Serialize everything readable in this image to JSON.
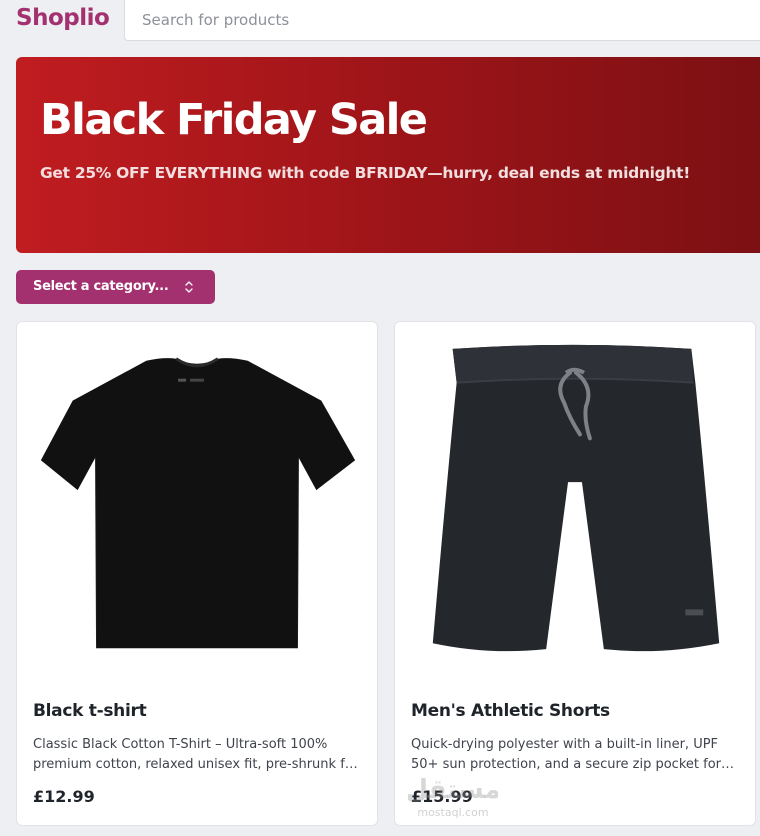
{
  "header": {
    "logo": "Shoplio",
    "search": {
      "placeholder": "Search for products",
      "value": ""
    }
  },
  "banner": {
    "title": "Black Friday Sale",
    "subtitle": "Get 25% OFF EVERYTHING with code BFRIDAY—hurry, deal ends at midnight!",
    "gradient_start": "#c01d20",
    "gradient_end": "#7b1013"
  },
  "category_select": {
    "label": "Select a category...",
    "icon": "chevron-updown-icon",
    "color": "#a3306f"
  },
  "products": [
    {
      "image": "black-tshirt-image",
      "name": "Black t-shirt",
      "description": "Classic Black Cotton T-Shirt – Ultra-soft 100% premium cotton, relaxed unisex fit, pre-shrunk for a lasting shape.",
      "price": "£12.99"
    },
    {
      "image": "athletic-shorts-image",
      "name": "Men's Athletic Shorts",
      "description": "Quick-drying polyester with a built-in liner, UPF 50+ sun protection, and a secure zip pocket for essentials.",
      "price": "£15.99"
    }
  ],
  "watermark": {
    "arabic": "مستقل",
    "latin": "mostaql.com"
  },
  "colors": {
    "brand": "#a3306f",
    "banner_red": "#b51a1d",
    "page_bg": "#eeeff3"
  }
}
